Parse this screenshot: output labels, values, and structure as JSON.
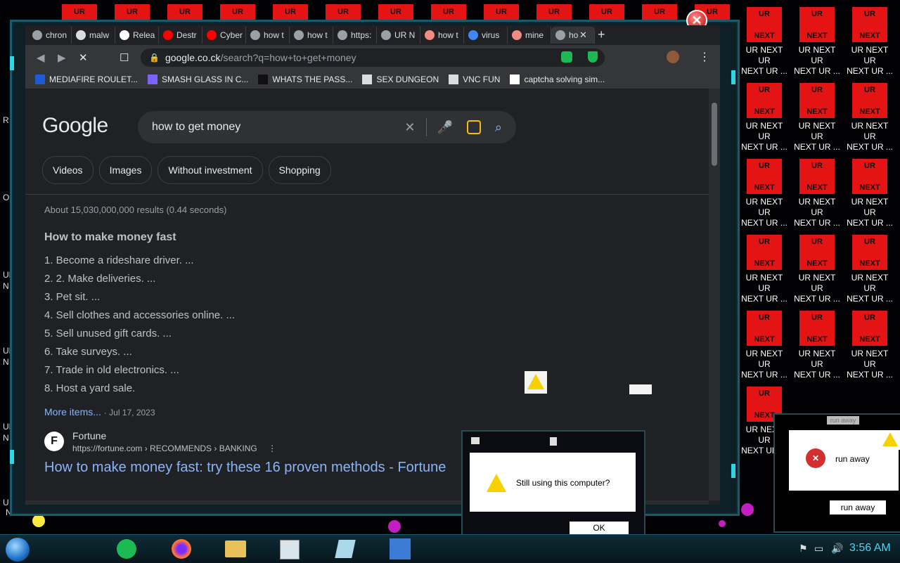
{
  "desktop": {
    "icon_tile_top": "UR",
    "icon_tile_bottom": "NEXT",
    "icon_caption_line1": "UR NEXT UR",
    "icon_caption_line2": "NEXT UR ...",
    "bottom_caption": "NEXT UR ...",
    "left_fragments": [
      "R",
      "OF",
      "UR",
      "N",
      "UR",
      "N",
      "UR",
      "N",
      "U"
    ]
  },
  "browser": {
    "tabs": [
      {
        "label": "chron",
        "icon": "history-icon",
        "color": "#9aa0a6"
      },
      {
        "label": "malw",
        "icon": "building-icon",
        "color": "#dadce0"
      },
      {
        "label": "Relea",
        "icon": "github-icon",
        "color": "#ffffff"
      },
      {
        "label": "Destr",
        "icon": "youtube-icon",
        "color": "#ff0000"
      },
      {
        "label": "Cyber",
        "icon": "youtube-icon",
        "color": "#ff0000"
      },
      {
        "label": "how t",
        "icon": "globe-icon",
        "color": "#9aa0a6"
      },
      {
        "label": "how t",
        "icon": "globe-icon",
        "color": "#9aa0a6"
      },
      {
        "label": "https:",
        "icon": "globe-icon",
        "color": "#9aa0a6"
      },
      {
        "label": "UR N",
        "icon": "globe-icon",
        "color": "#9aa0a6"
      },
      {
        "label": "how t",
        "icon": "swirl-icon",
        "color": "#f28b82"
      },
      {
        "label": "virus",
        "icon": "google-icon",
        "color": "#4285f4"
      },
      {
        "label": "mine",
        "icon": "swirl-icon",
        "color": "#f28b82"
      },
      {
        "label": "ho",
        "icon": "loading-icon",
        "color": "#9aa0a6"
      }
    ],
    "url_host": "google.co.ck",
    "url_path": "/search?q=how+to+get+money",
    "bookmarks": [
      {
        "label": "MEDIAFIRE ROULET...",
        "icon": "mediafire-icon",
        "color": "#1d5bd6"
      },
      {
        "label": "SMASH GLASS IN C...",
        "icon": "vs-icon",
        "color": "#7b61ff"
      },
      {
        "label": "WHATS THE PASS...",
        "icon": "black-square-icon",
        "color": "#111111"
      },
      {
        "label": "SEX DUNGEON",
        "icon": "robot-icon",
        "color": "#dadce0"
      },
      {
        "label": "VNC FUN",
        "icon": "robot-icon",
        "color": "#dadce0"
      },
      {
        "label": "captcha solving sim...",
        "icon": "lambda-icon",
        "color": "#ffffff"
      }
    ]
  },
  "google": {
    "logo": "Google",
    "query": "how to get money",
    "chips": [
      "Videos",
      "Images",
      "Without investment",
      "Shopping"
    ],
    "stats": "About 15,030,000,000 results (0.44 seconds)",
    "snippet_title": "How to make money fast",
    "list": [
      "1. Become a rideshare driver. ...",
      "2. 2. Make deliveries. ...",
      "3. Pet sit. ...",
      "4. Sell clothes and accessories online. ...",
      "5. Sell unused gift cards. ...",
      "6. Take surveys. ...",
      "7. Trade in old electronics. ...",
      "8. Host a yard sale."
    ],
    "more_items": "More items...",
    "more_date": "Jul 17, 2023",
    "result": {
      "logo_letter": "F",
      "site_name": "Fortune",
      "url": "https://fortune.com › RECOMMENDS › BANKING",
      "title": "How to make money fast: try these 16 proven methods - Fortune"
    }
  },
  "dialog": {
    "message": "Still using this computer?",
    "ok_label": "OK"
  },
  "dialog2": {
    "message": "run away",
    "button_label": "run away",
    "title_fragment": "run away"
  },
  "taskbar": {
    "clock": "3:56 AM"
  }
}
